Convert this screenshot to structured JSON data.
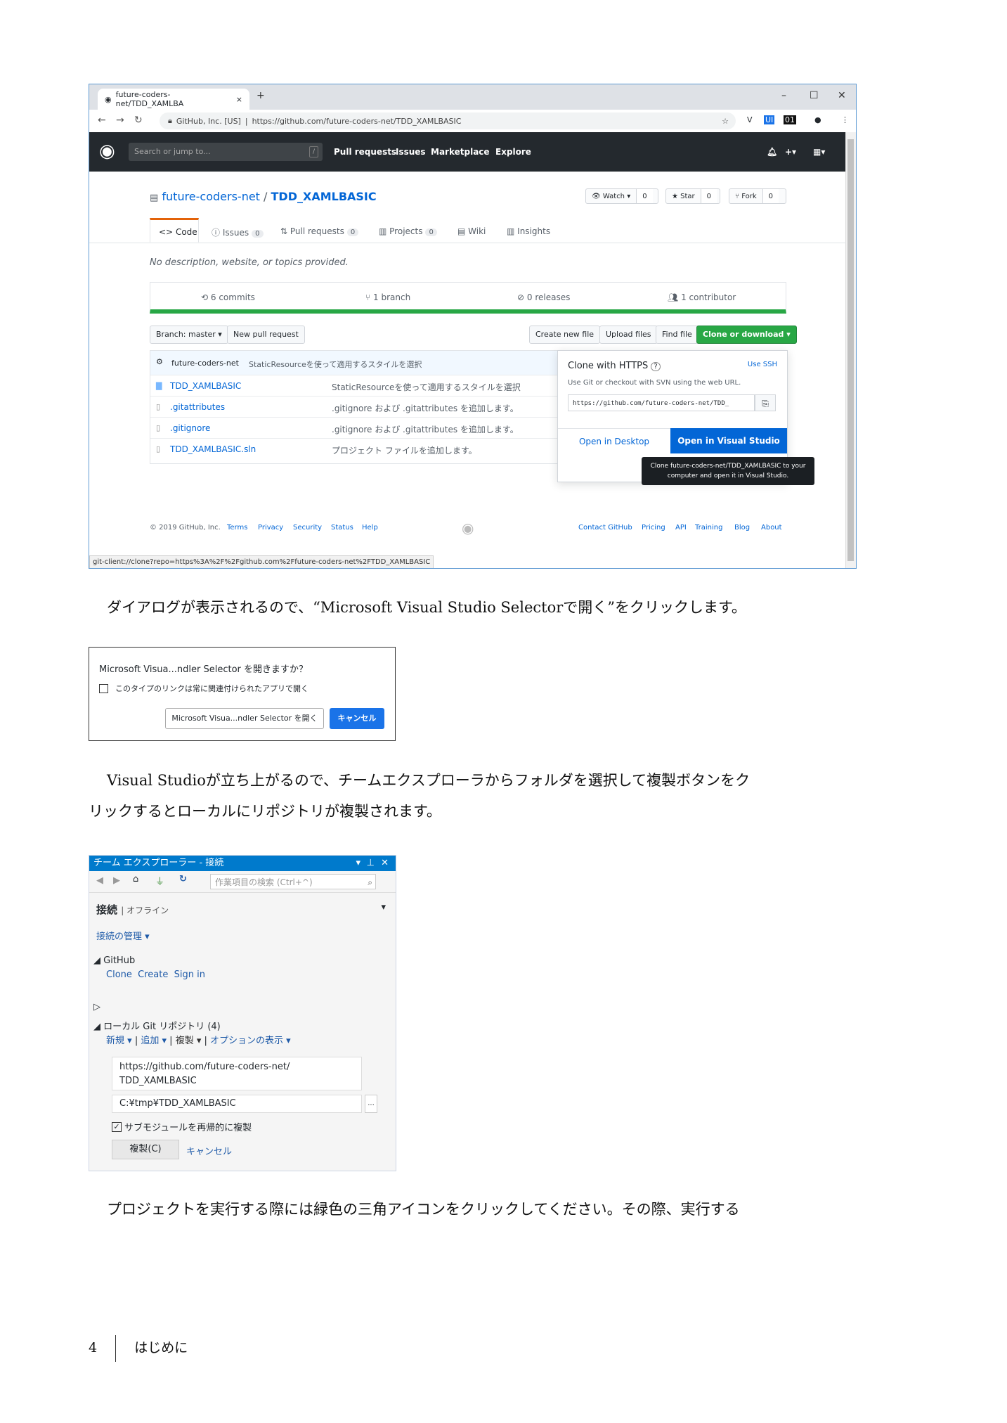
{
  "browser": {
    "tab_title": "future-coders-net/TDD_XAMLBA",
    "tab_close": "×",
    "new_tab": "+",
    "win_min": "–",
    "win_max": "☐",
    "win_close": "✕",
    "url_org": "GitHub, Inc. [US]",
    "url": "https://github.com/future-coders-net/TDD_XAMLBASIC",
    "status_url": "git-client://clone?repo=https%3A%2F%2Fgithub.com%2Ffuture-coders-net%2FTDD_XAMLBASIC"
  },
  "github": {
    "search_placeholder": "Search or jump to...",
    "search_slash": "/",
    "nav": [
      "Pull requests",
      "Issues",
      "Marketplace",
      "Explore"
    ],
    "repo_owner": "future-coders-net",
    "repo_sep": " / ",
    "repo_name": "TDD_XAMLBASIC",
    "watch_label": "Watch ▾",
    "watch_count": "0",
    "star_label": "Star",
    "star_count": "0",
    "fork_label": "Fork",
    "fork_count": "0",
    "tabs": {
      "code": "Code",
      "issues": "Issues",
      "issues_count": "0",
      "pulls": "Pull requests",
      "pulls_count": "0",
      "projects": "Projects",
      "projects_count": "0",
      "wiki": "Wiki",
      "insights": "Insights"
    },
    "description": "No description, website, or topics provided.",
    "summary": {
      "commits": "6 commits",
      "branch": "1 branch",
      "releases": "0 releases",
      "contributor": "1 contributor"
    },
    "buttons": {
      "branch": "Branch: master ▾",
      "new_pr": "New pull request",
      "create_file": "Create new file",
      "upload": "Upload files",
      "find": "Find file",
      "clone": "Clone or download ▾"
    },
    "last_commit_author": "future-coders-net",
    "last_commit_msg": "StaticResourceを使って適用するスタイルを選択",
    "files": [
      {
        "name": "TDD_XAMLBASIC",
        "msg": "StaticResourceを使って適用するスタイルを選択",
        "icon": "folder"
      },
      {
        "name": ".gitattributes",
        "msg": ".gitignore および .gitattributes を追加します。",
        "icon": "file"
      },
      {
        "name": ".gitignore",
        "msg": ".gitignore および .gitattributes を追加します。",
        "icon": "file"
      },
      {
        "name": "TDD_XAMLBASIC.sln",
        "msg": "プロジェクト ファイルを追加します。",
        "icon": "file"
      }
    ],
    "clone_pop": {
      "title": "Clone with HTTPS",
      "help": "?",
      "use_ssh": "Use SSH",
      "hint": "Use Git or checkout with SVN using the web URL.",
      "url": "https://github.com/future-coders-net/TDD_",
      "open_desktop": "Open in Desktop",
      "open_vs": "Open in Visual Studio"
    },
    "tooltip_line1": "Clone future-coders-net/TDD_XAMLBASIC to your",
    "tooltip_line2": "computer and open it in Visual Studio.",
    "footer_left": [
      "© 2019 GitHub, Inc.",
      "Terms",
      "Privacy",
      "Security",
      "Status",
      "Help"
    ],
    "footer_right": [
      "Contact GitHub",
      "Pricing",
      "API",
      "Training",
      "Blog",
      "About"
    ]
  },
  "text1": "ダイアログが表示されるので、“Microsoft Visual Studio Selectorで開く”をクリックします。",
  "dialog": {
    "title": "Microsoft Visua...ndler Selector を開きますか？",
    "checkbox": "このタイプのリンクは常に関連付けられたアプリで開く",
    "open": "Microsoft Visua...ndler Selector を開く",
    "cancel": "キャンセル"
  },
  "text2a": "Visual Studioが立ち上がるので、チームエクスプローラからフォルダを選択して複製ボタンをク",
  "text2b": "リックするとローカルにリポジトリが複製されます。",
  "team": {
    "header": "チーム エクスプローラー - 接続",
    "search_placeholder": "作業項目の検索 (Ctrl+^)",
    "connect": "接続",
    "offline": "オフライン",
    "manage": "接続の管理",
    "github": "GitHub",
    "clone": "Clone",
    "create": "Create",
    "signin": "Sign in",
    "local_repos": "ローカル Git リポジトリ (4)",
    "new": "新規",
    "add": "追加",
    "dup": "複製",
    "options": "オプションの表示",
    "url_line1": "https://github.com/future-coders-net/",
    "url_line2": "TDD_XAMLBASIC",
    "path": "C:¥tmp¥TDD_XAMLBASIC",
    "browse": "...",
    "recursive": "サブモジュールを再帰的に複製",
    "clone_btn": "複製(C)",
    "cancel": "キャンセル"
  },
  "text3": "プロジェクトを実行する際には緑色の三角アイコンをクリックしてください。その際、実行する",
  "footer": {
    "page": "4",
    "chapter": "はじめに"
  }
}
